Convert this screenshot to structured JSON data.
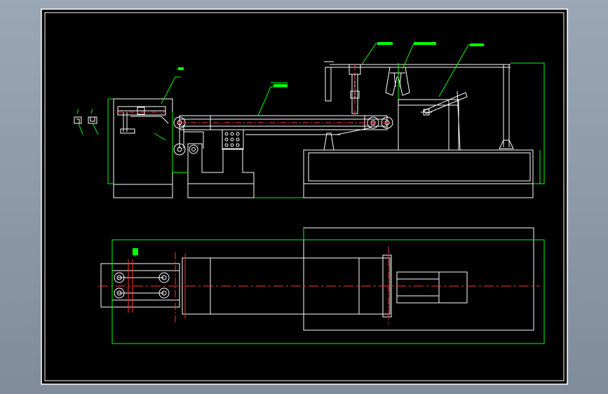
{
  "background": {
    "top_color": "#9aa7b5",
    "bottom_color": "#7f8c9a"
  },
  "sheet": {
    "paper_color": "#000000",
    "border_color": "#ffffff"
  },
  "colors": {
    "outline": "#ffffff",
    "dimension": "#00ff00",
    "centerline": "#ff0000",
    "hidden": "#ff3333"
  },
  "views": {
    "front_view": {
      "label": "front-elevation"
    },
    "top_view": {
      "label": "plan-view"
    }
  }
}
